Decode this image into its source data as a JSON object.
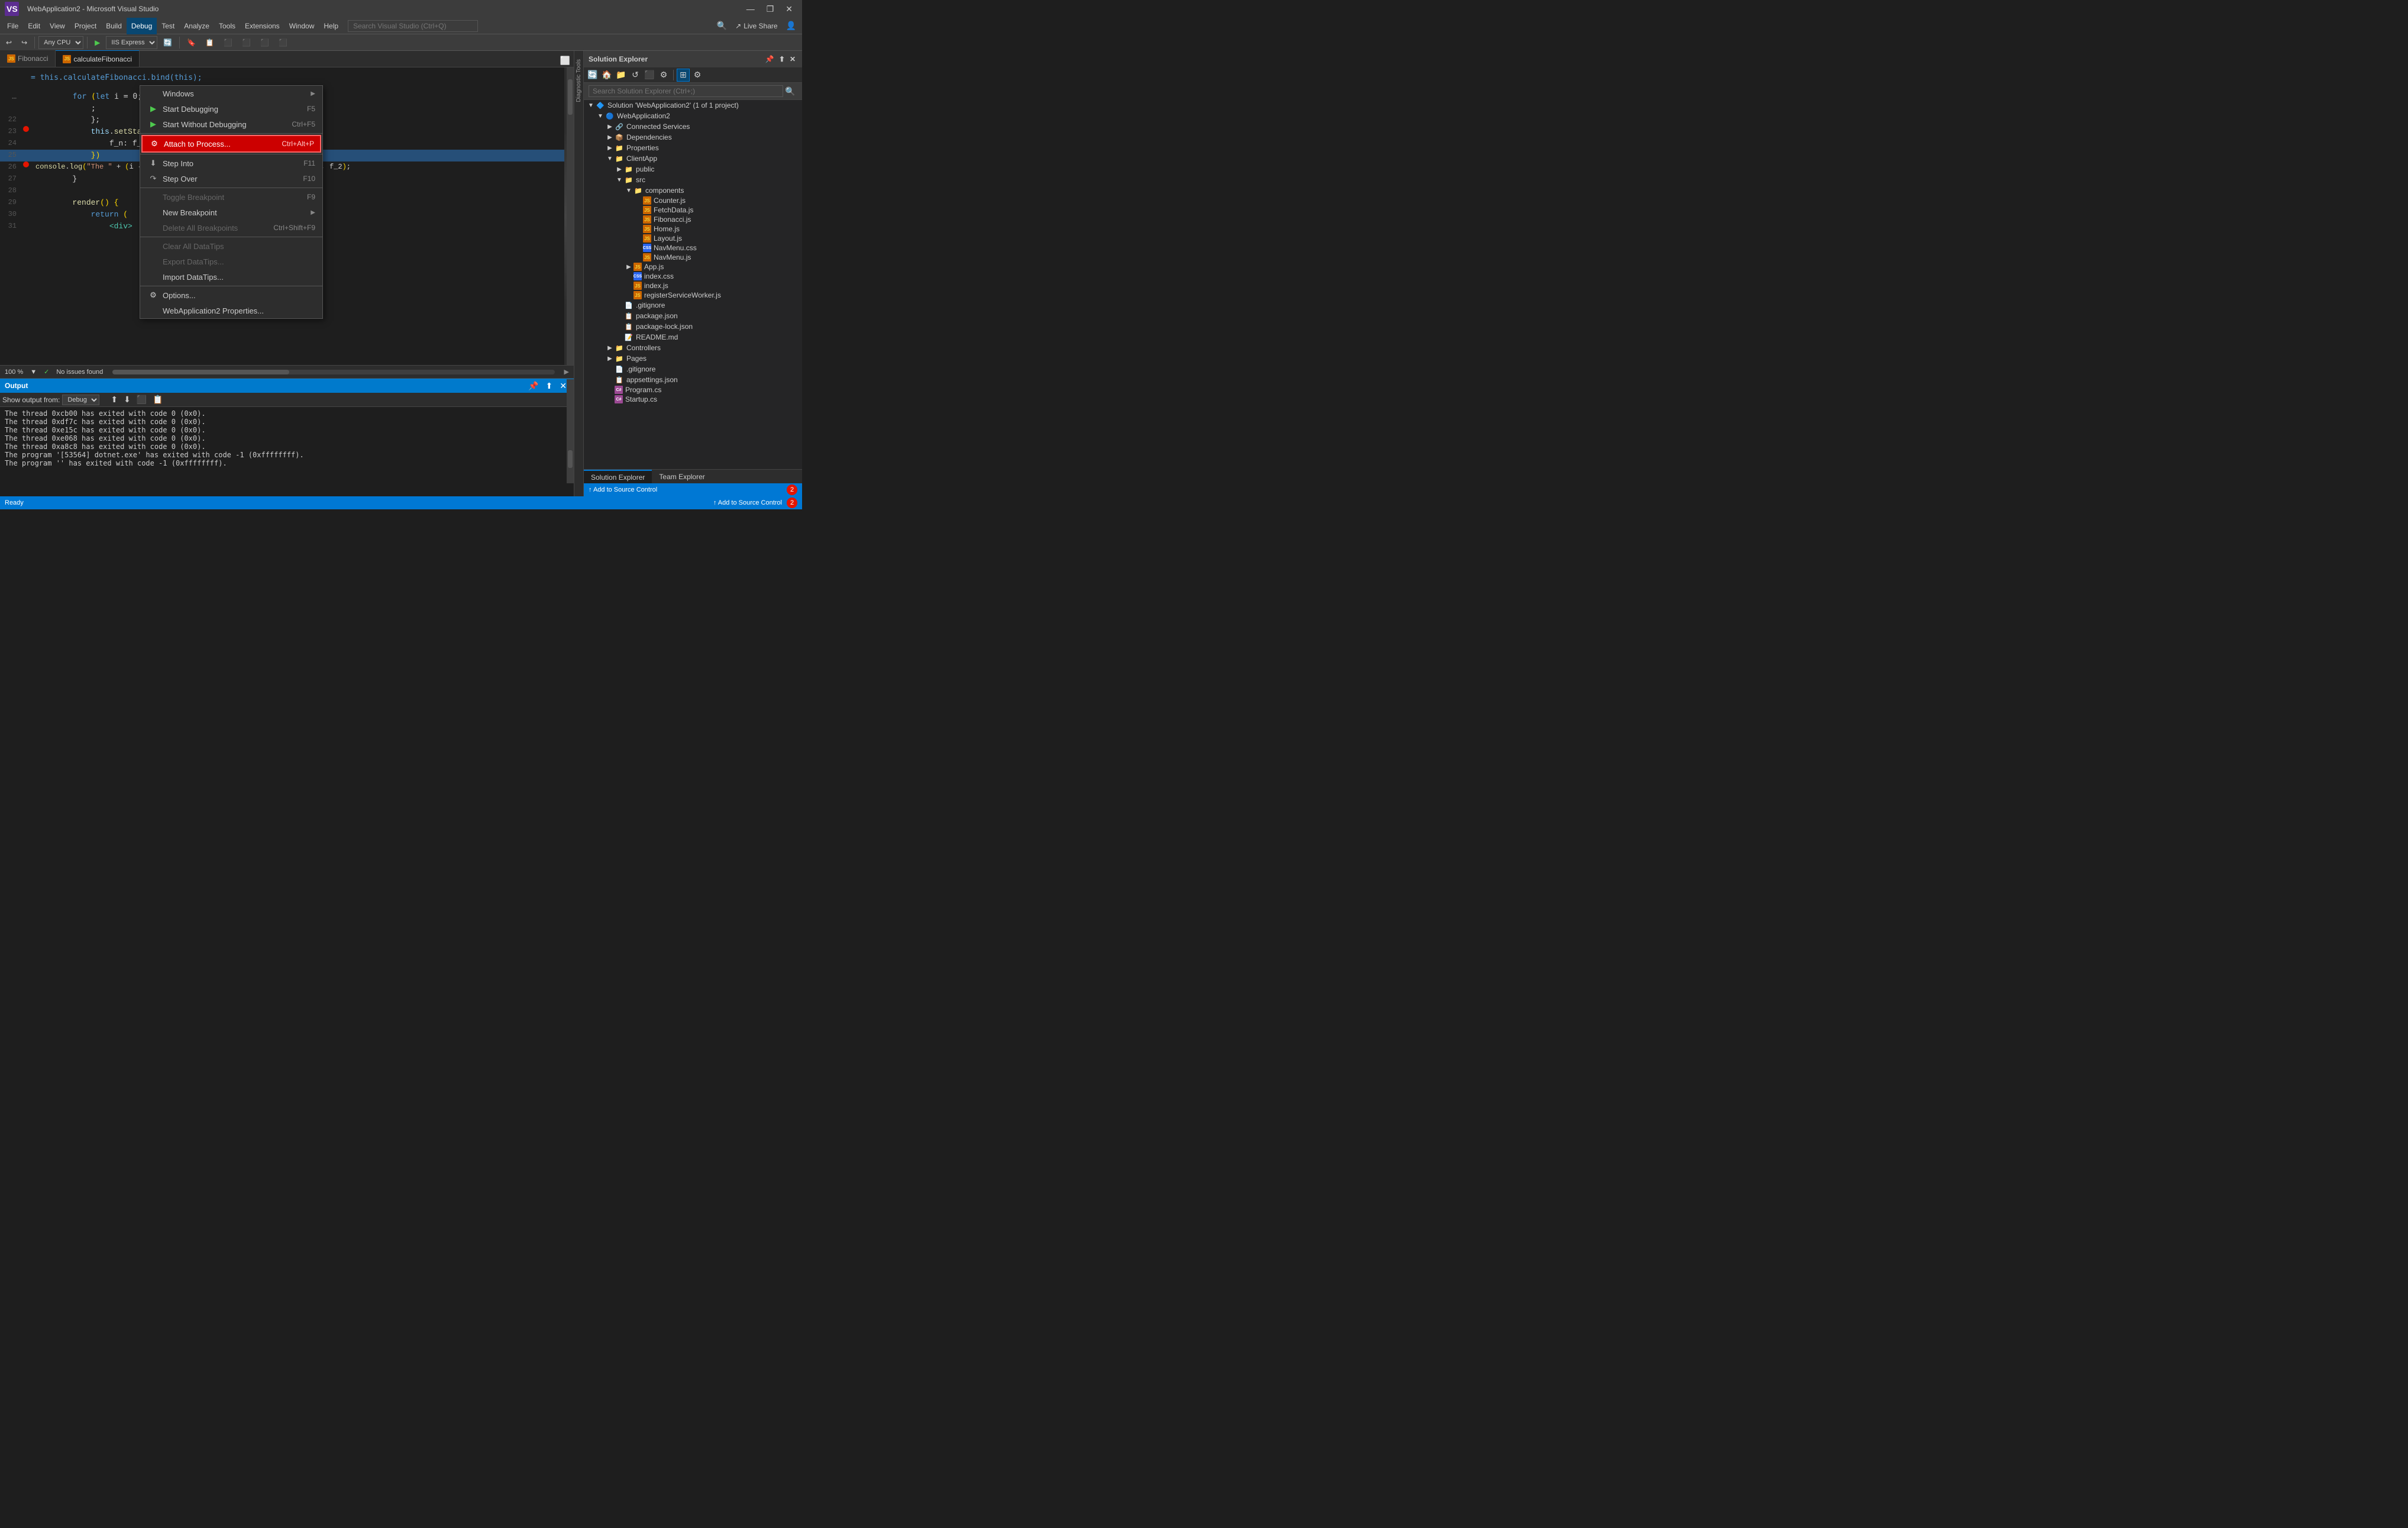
{
  "titleBar": {
    "title": "WebApplication2 - Microsoft Visual Studio",
    "minimizeLabel": "—",
    "restoreLabel": "❐",
    "closeLabel": "✕",
    "logoAlt": "VS"
  },
  "menuBar": {
    "items": [
      {
        "label": "File",
        "id": "file"
      },
      {
        "label": "Edit",
        "id": "edit"
      },
      {
        "label": "View",
        "id": "view"
      },
      {
        "label": "Project",
        "id": "project"
      },
      {
        "label": "Build",
        "id": "build"
      },
      {
        "label": "Debug",
        "id": "debug"
      },
      {
        "label": "Test",
        "id": "test"
      },
      {
        "label": "Analyze",
        "id": "analyze"
      },
      {
        "label": "Tools",
        "id": "tools"
      },
      {
        "label": "Extensions",
        "id": "extensions"
      },
      {
        "label": "Window",
        "id": "window"
      },
      {
        "label": "Help",
        "id": "help"
      }
    ],
    "searchPlaceholder": "Search Visual Studio (Ctrl+Q)"
  },
  "toolbar": {
    "config": "Any CPU",
    "server": "IIS Express",
    "liveshare": "Live Share"
  },
  "tabs": {
    "items": [
      {
        "label": "Fibonacci",
        "active": false
      },
      {
        "label": "calculateFibonacci",
        "active": true
      }
    ]
  },
  "debugMenu": {
    "items": [
      {
        "label": "Windows",
        "type": "submenu",
        "icon": "",
        "id": "windows"
      },
      {
        "label": "Start Debugging",
        "shortcut": "F5",
        "icon": "▶",
        "id": "start-debugging"
      },
      {
        "label": "Start Without Debugging",
        "shortcut": "Ctrl+F5",
        "icon": "▶",
        "id": "start-without-debugging"
      },
      {
        "type": "separator"
      },
      {
        "label": "Attach to Process...",
        "shortcut": "Ctrl+Alt+P",
        "icon": "⚙",
        "id": "attach-to-process",
        "highlighted": true
      },
      {
        "type": "separator"
      },
      {
        "label": "Step Into",
        "shortcut": "F11",
        "icon": "⬇",
        "id": "step-into"
      },
      {
        "label": "Step Over",
        "shortcut": "F10",
        "icon": "↷",
        "id": "step-over"
      },
      {
        "type": "separator"
      },
      {
        "label": "Toggle Breakpoint",
        "shortcut": "F9",
        "id": "toggle-breakpoint",
        "disabled": true
      },
      {
        "label": "New Breakpoint",
        "type": "submenu",
        "id": "new-breakpoint"
      },
      {
        "label": "Delete All Breakpoints",
        "shortcut": "Ctrl+Shift+F9",
        "id": "delete-all-breakpoints",
        "disabled": true
      },
      {
        "type": "separator"
      },
      {
        "label": "Clear All DataTips",
        "id": "clear-datatips",
        "disabled": true
      },
      {
        "label": "Export DataTips...",
        "id": "export-datatips",
        "disabled": true
      },
      {
        "label": "Import DataTips...",
        "id": "import-datatips"
      },
      {
        "type": "separator"
      },
      {
        "label": "Options...",
        "icon": "⚙",
        "id": "options"
      },
      {
        "label": "WebApplication2 Properties...",
        "id": "properties"
      }
    ]
  },
  "codeLines": [
    {
      "num": "22",
      "code": "            };",
      "indent": 0
    },
    {
      "num": "23",
      "code": "            this.setState({",
      "bp": true,
      "indent": 0
    },
    {
      "num": "24",
      "code": "                f_n: f_2",
      "indent": 0
    },
    {
      "num": "25",
      "code": "            });",
      "highlighted": true,
      "indent": 0
    },
    {
      "num": "26",
      "code": "            console.log(\"The \" + (i - 1).toString() + \"th Fibonnaci number is:\", f_2);",
      "bp": true,
      "indent": 0
    },
    {
      "num": "27",
      "code": "        }",
      "indent": 0
    },
    {
      "num": "28",
      "code": "",
      "indent": 0
    },
    {
      "num": "29",
      "code": "        render() {",
      "indent": 0
    },
    {
      "num": "30",
      "code": "            return (",
      "indent": 0
    },
    {
      "num": "31",
      "code": "                <div>",
      "indent": 0
    }
  ],
  "outputPanel": {
    "title": "Output",
    "source": "Debug",
    "lines": [
      "The thread 0xcb00 has exited with code 0 (0x0).",
      "The thread 0xdf7c has exited with code 0 (0x0).",
      "The thread 0xe15c has exited with code 0 (0x0).",
      "The thread 0xe068 has exited with code 0 (0x0).",
      "The thread 0xa8c8 has exited with code 0 (0x0).",
      "The program '[53564] dotnet.exe' has exited with code -1 (0xffffffff).",
      "The program '' has exited with code -1 (0xffffffff)."
    ]
  },
  "solutionExplorer": {
    "title": "Solution Explorer",
    "searchPlaceholder": "Search Solution Explorer (Ctrl+;)",
    "tree": [
      {
        "label": "Solution 'WebApplication2' (1 of 1 project)",
        "type": "solution",
        "expanded": true,
        "indent": 0
      },
      {
        "label": "WebApplication2",
        "type": "project",
        "expanded": true,
        "indent": 1
      },
      {
        "label": "Connected Services",
        "type": "folder",
        "indent": 2
      },
      {
        "label": "Dependencies",
        "type": "folder",
        "expanded": false,
        "indent": 2
      },
      {
        "label": "Properties",
        "type": "folder",
        "expanded": false,
        "indent": 2
      },
      {
        "label": "ClientApp",
        "type": "folder",
        "expanded": true,
        "indent": 2
      },
      {
        "label": "public",
        "type": "folder",
        "expanded": false,
        "indent": 3
      },
      {
        "label": "src",
        "type": "folder",
        "expanded": true,
        "indent": 3
      },
      {
        "label": "components",
        "type": "folder",
        "expanded": true,
        "indent": 4
      },
      {
        "label": "Counter.js",
        "type": "js",
        "indent": 5
      },
      {
        "label": "FetchData.js",
        "type": "js",
        "indent": 5
      },
      {
        "label": "Fibonacci.js",
        "type": "js",
        "indent": 5
      },
      {
        "label": "Home.js",
        "type": "js",
        "indent": 5
      },
      {
        "label": "Layout.js",
        "type": "js",
        "indent": 5
      },
      {
        "label": "NavMenu.css",
        "type": "css",
        "indent": 5
      },
      {
        "label": "NavMenu.js",
        "type": "js",
        "indent": 5
      },
      {
        "label": "App.js",
        "type": "js",
        "expanded": false,
        "indent": 4
      },
      {
        "label": "index.css",
        "type": "css",
        "indent": 4
      },
      {
        "label": "index.js",
        "type": "js",
        "indent": 4
      },
      {
        "label": "registerServiceWorker.js",
        "type": "js",
        "indent": 4
      },
      {
        "label": ".gitignore",
        "type": "file",
        "indent": 3
      },
      {
        "label": "package.json",
        "type": "json",
        "indent": 3
      },
      {
        "label": "package-lock.json",
        "type": "json",
        "indent": 3
      },
      {
        "label": "README.md",
        "type": "md",
        "indent": 3
      },
      {
        "label": "Controllers",
        "type": "folder",
        "expanded": false,
        "indent": 2
      },
      {
        "label": "Pages",
        "type": "folder",
        "expanded": false,
        "indent": 2
      },
      {
        "label": ".gitignore",
        "type": "file",
        "indent": 2
      },
      {
        "label": "appsettings.json",
        "type": "json",
        "indent": 2
      },
      {
        "label": "Program.cs",
        "type": "cs",
        "indent": 2
      },
      {
        "label": "Startup.cs",
        "type": "cs",
        "indent": 2
      }
    ],
    "bottomTabs": [
      "Solution Explorer",
      "Team Explorer"
    ],
    "activeBottomTab": "Solution Explorer",
    "footerLabel": "↑ Add to Source Control",
    "notifCount": "2"
  },
  "statusBar": {
    "readyLabel": "Ready",
    "addSourceControl": "↑ Add to Source Control",
    "notifCount": "2"
  },
  "editorBottomBar": {
    "zoom": "100 %",
    "status": "✓ No issues found"
  },
  "diagnosticTools": {
    "label": "Diagnostic Tools"
  }
}
